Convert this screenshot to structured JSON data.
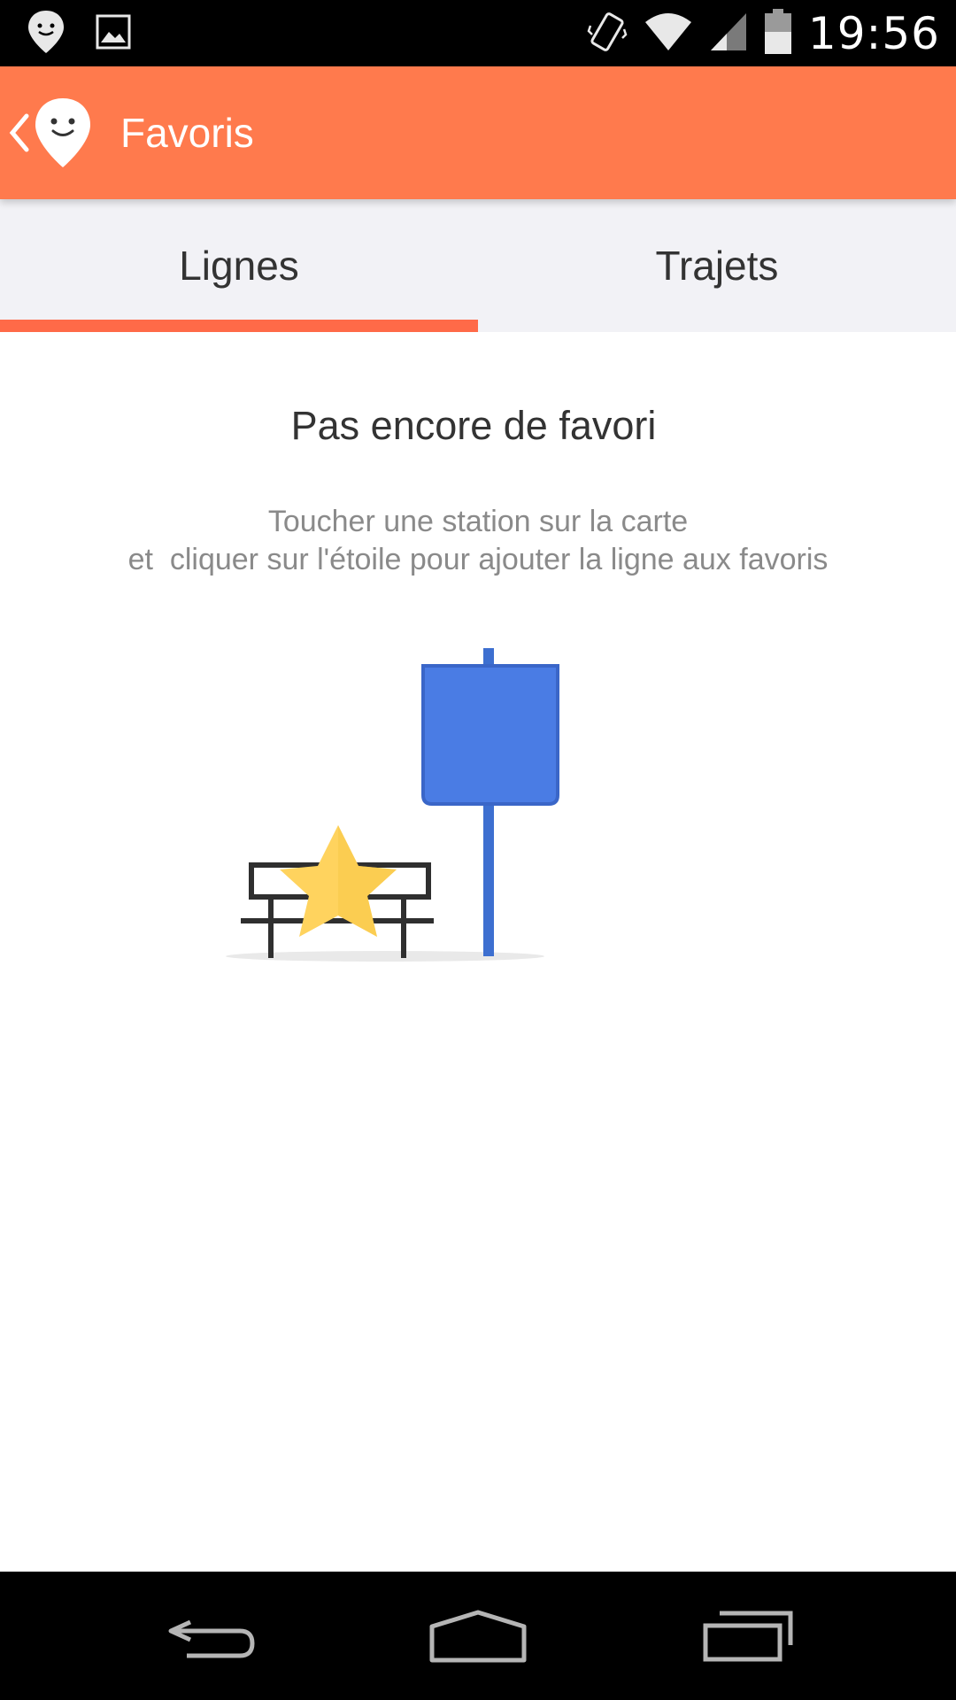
{
  "status_bar": {
    "time": "19:56",
    "icons": [
      "moovit-notification-icon",
      "image-notification-icon",
      "vibrate-icon",
      "wifi-icon",
      "signal-icon",
      "battery-icon"
    ]
  },
  "app_bar": {
    "title": "Favoris",
    "background_color": "#ff7a4d"
  },
  "tabs": [
    {
      "label": "Lignes",
      "selected": true
    },
    {
      "label": "Trajets",
      "selected": false
    }
  ],
  "tab_indicator_color": "#ff6a48",
  "empty_state": {
    "title": "Pas encore de favori",
    "line1": "Toucher une station sur la carte",
    "line2": "et  cliquer sur l'étoile pour ajouter la ligne aux favoris",
    "illustration": "bench-star-bus-stop-illustration"
  },
  "nav_bar": {
    "buttons": [
      "back-icon",
      "home-icon",
      "recents-icon"
    ]
  }
}
